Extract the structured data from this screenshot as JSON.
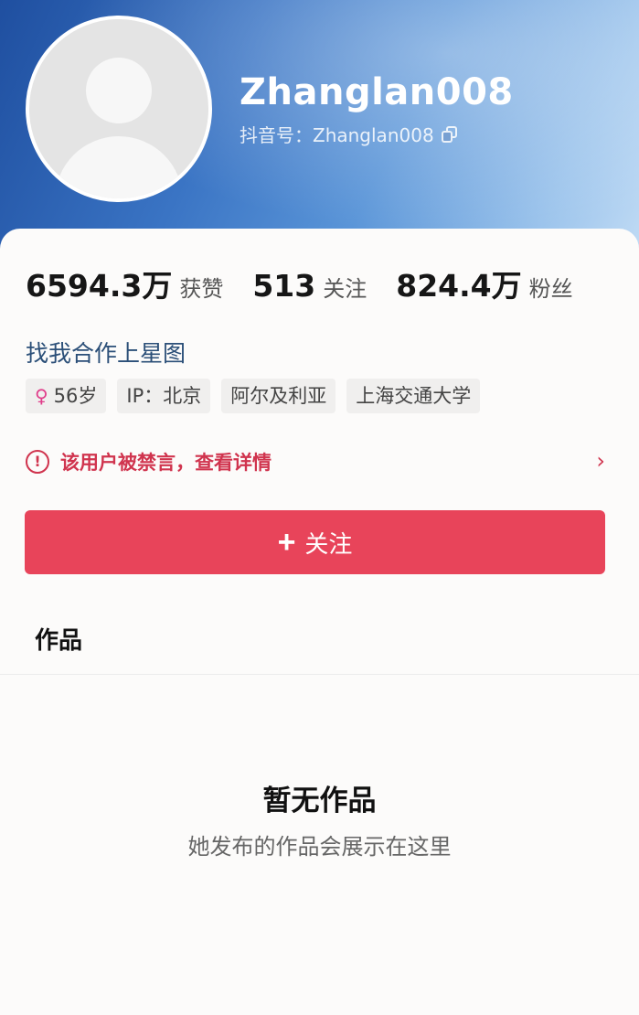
{
  "profile": {
    "username": "Zhanglan008",
    "douyin_id": "抖音号：Zhanglan008",
    "avatar_icon": "default-avatar-icon",
    "copy_icon": "copy-icon"
  },
  "stats": [
    {
      "value": "6594.3万",
      "label": "获赞"
    },
    {
      "value": "513",
      "label": "关注"
    },
    {
      "value": "824.4万",
      "label": "粉丝"
    }
  ],
  "xingtu_link": "找我合作上星图",
  "tags": {
    "age": "56岁",
    "ip": "IP：北京",
    "location": "阿尔及利亚",
    "school": "上海交通大学"
  },
  "ban_notice": {
    "icon": "!",
    "text": "该用户被禁言，查看详情",
    "chevron": "›"
  },
  "follow_button": {
    "plus": "+",
    "label": "关注"
  },
  "tabs": {
    "works": "作品"
  },
  "empty_state": {
    "title": "暂无作品",
    "subtitle": "她发布的作品会展示在这里"
  },
  "colors": {
    "accent": "#e8445a",
    "warning": "#d0344e",
    "link": "#2b4f78",
    "female": "#e03c8a"
  }
}
